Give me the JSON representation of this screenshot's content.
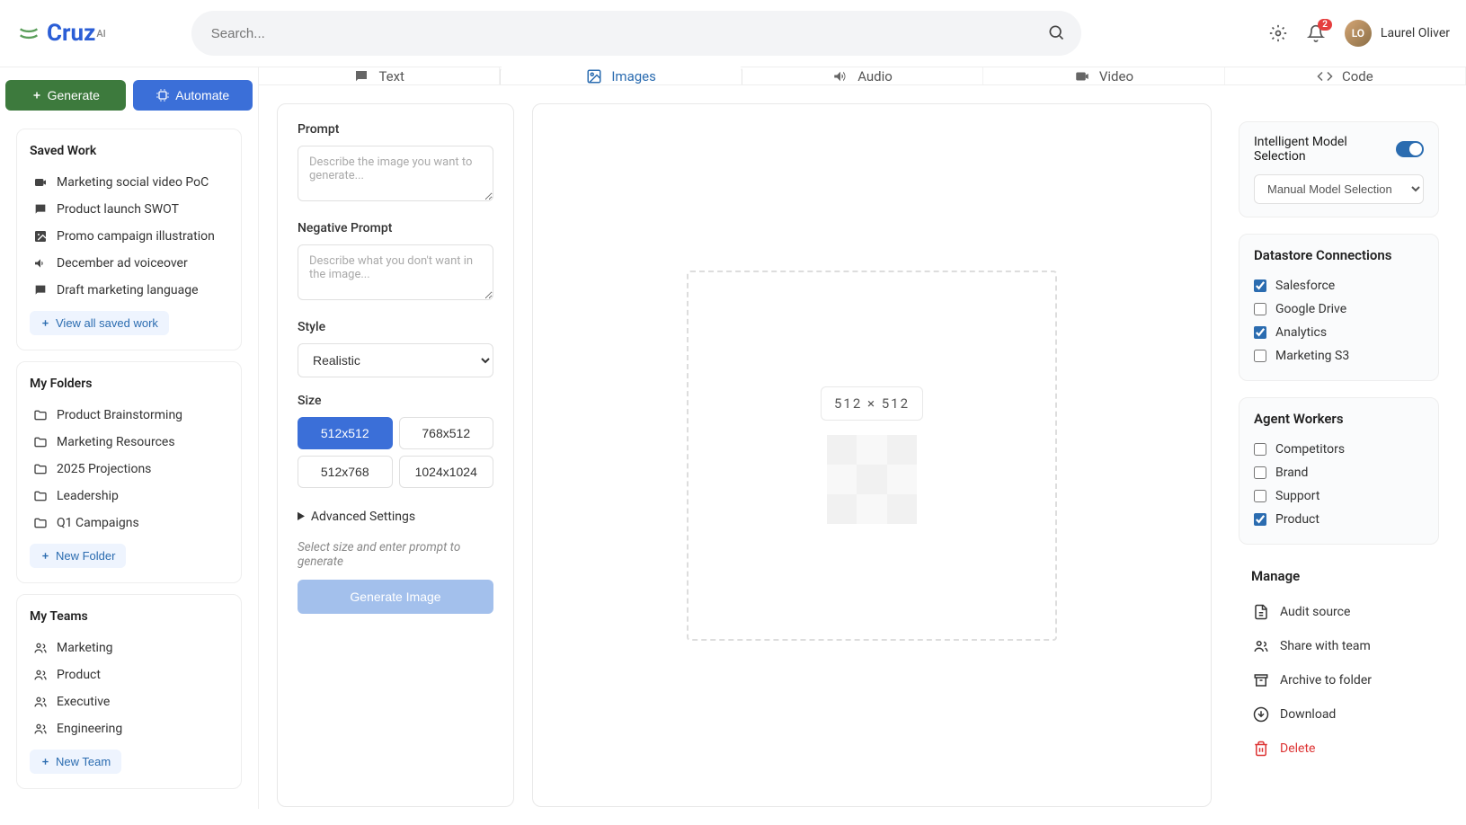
{
  "brand": {
    "name": "Cruz",
    "suffix": "AI"
  },
  "search": {
    "placeholder": "Search..."
  },
  "notifications": {
    "count": "2"
  },
  "user": {
    "name": "Laurel Oliver",
    "initials": "LO"
  },
  "top_buttons": {
    "generate": "Generate",
    "automate": "Automate"
  },
  "saved_work": {
    "title": "Saved Work",
    "items": [
      "Marketing social video PoC",
      "Product launch SWOT",
      "Promo campaign illustration",
      "December ad voiceover",
      "Draft marketing language"
    ],
    "view_all": "View all saved work"
  },
  "folders": {
    "title": "My Folders",
    "items": [
      "Product Brainstorming",
      "Marketing Resources",
      "2025 Projections",
      "Leadership",
      "Q1 Campaigns"
    ],
    "new": "New Folder"
  },
  "teams": {
    "title": "My Teams",
    "items": [
      "Marketing",
      "Product",
      "Executive",
      "Engineering"
    ],
    "new": "New Team"
  },
  "tabs": {
    "text": "Text",
    "images": "Images",
    "audio": "Audio",
    "video": "Video",
    "code": "Code"
  },
  "form": {
    "prompt_label": "Prompt",
    "prompt_ph": "Describe the image you want to generate...",
    "neg_label": "Negative Prompt",
    "neg_ph": "Describe what you don't want in the image...",
    "style_label": "Style",
    "style_value": "Realistic",
    "size_label": "Size",
    "sizes": [
      "512x512",
      "768x512",
      "512x768",
      "1024x1024"
    ],
    "advanced": "Advanced Settings",
    "hint": "Select size and enter prompt to generate",
    "generate": "Generate Image"
  },
  "canvas": {
    "dims": "512  ×  512"
  },
  "right": {
    "model_label": "Intelligent Model Selection",
    "manual_label": "Manual Model Selection",
    "datastore": {
      "title": "Datastore Connections",
      "items": [
        {
          "label": "Salesforce",
          "checked": true
        },
        {
          "label": "Google Drive",
          "checked": false
        },
        {
          "label": "Analytics",
          "checked": true
        },
        {
          "label": "Marketing S3",
          "checked": false
        }
      ]
    },
    "agents": {
      "title": "Agent Workers",
      "items": [
        {
          "label": "Competitors",
          "checked": false
        },
        {
          "label": "Brand",
          "checked": false
        },
        {
          "label": "Support",
          "checked": false
        },
        {
          "label": "Product",
          "checked": true
        }
      ]
    },
    "manage": {
      "title": "Manage",
      "items": [
        "Audit source",
        "Share with team",
        "Archive to folder",
        "Download",
        "Delete"
      ]
    }
  }
}
